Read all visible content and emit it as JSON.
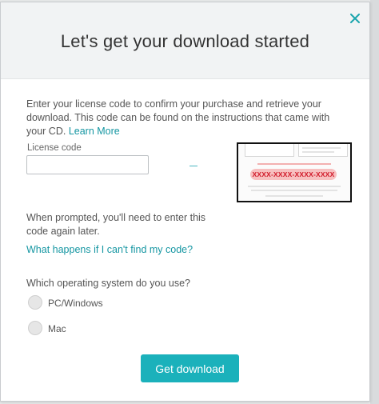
{
  "modal": {
    "title": "Let's get your download started",
    "close_icon": "close-icon",
    "intro_text": "Enter your license code to confirm your purchase and retrieve your download. This code can be found on the instructions that came with your CD.",
    "learn_more": "Learn More",
    "license_label": "License code",
    "license_value": "",
    "license_placeholder": "",
    "hint_image": {
      "code_example": "XXXX-XXXX-XXXX-XXXX"
    },
    "prompted_text": "When prompted, you'll need to enter this code again later.",
    "missing_code_link": "What happens if I can't find my code?",
    "os_question": "Which operating system do you use?",
    "os_options": [
      {
        "label": "PC/Windows",
        "selected": false
      },
      {
        "label": "Mac",
        "selected": false
      }
    ],
    "submit_button": "Get download"
  },
  "colors": {
    "accent": "#1bb1bb",
    "link": "#1596a2",
    "header_bg": "#f1f3f4",
    "code_red": "#d11a2a"
  }
}
